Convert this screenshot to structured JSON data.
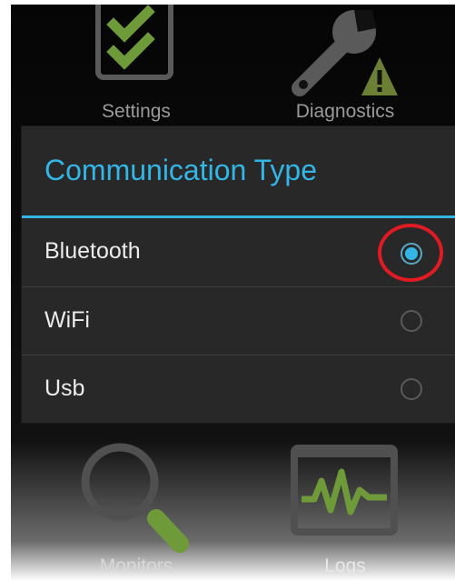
{
  "home_tiles": [
    {
      "label": "Settings",
      "icon": "checklist-icon"
    },
    {
      "label": "Diagnostics",
      "icon": "wrench-warning-icon"
    },
    {
      "label": "Monitors",
      "icon": "magnifier-icon"
    },
    {
      "label": "Logs",
      "icon": "waveform-icon"
    }
  ],
  "dialog": {
    "title": "Communication Type",
    "options": [
      {
        "label": "Bluetooth",
        "selected": true
      },
      {
        "label": "WiFi",
        "selected": false
      },
      {
        "label": "Usb",
        "selected": false
      }
    ]
  },
  "colors": {
    "accent": "#33b5e5",
    "highlight": "#e01b24",
    "icon_green": "#6f9a3a"
  }
}
